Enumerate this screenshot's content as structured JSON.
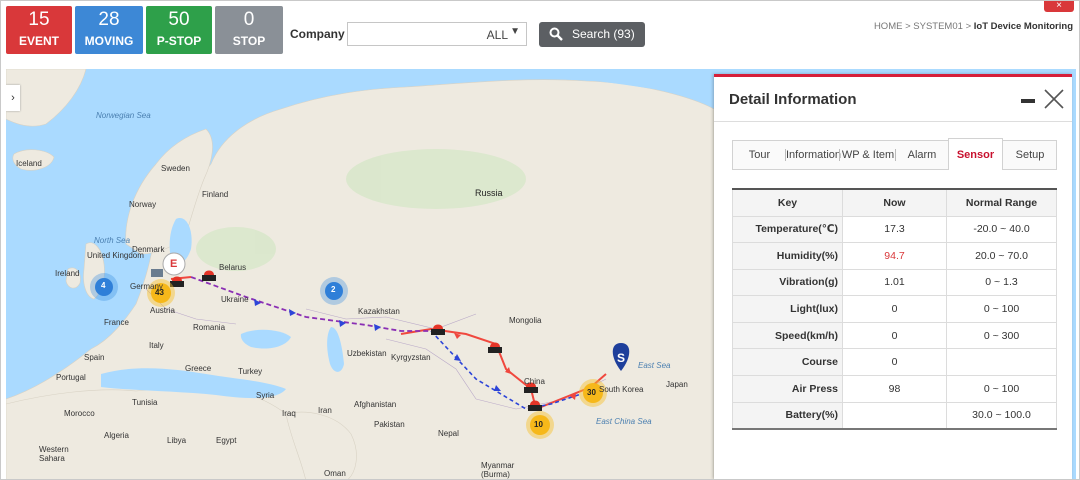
{
  "stats": [
    {
      "count": "15",
      "label": "EVENT",
      "color": "#d9383a"
    },
    {
      "count": "28",
      "label": "MOVING",
      "color": "#3d88d6"
    },
    {
      "count": "50",
      "label": "P-STOP",
      "color": "#2ea04a"
    },
    {
      "count": "0",
      "label": "STOP",
      "color": "#8a9097"
    }
  ],
  "filter": {
    "company_label": "Company :",
    "company_value": "ALL",
    "search_label": "Search (93)"
  },
  "breadcrumb": {
    "home": "HOME",
    "sep1": ">",
    "system": "SYSTEM01",
    "sep2": ">",
    "current": "IoT Device Monitoring"
  },
  "map": {
    "labels": {
      "norwegian_sea": "Norwegian Sea",
      "iceland": "Iceland",
      "sweden": "Sweden",
      "finland": "Finland",
      "norway": "Norway",
      "north_sea": "North Sea",
      "united_kingdom": "United Kingdom",
      "denmark": "Denmark",
      "ireland": "Ireland",
      "belarus": "Belarus",
      "germany": "Germany",
      "ukraine": "Ukraine",
      "france": "France",
      "austria": "Austria",
      "romania": "Romania",
      "kazakhstan": "Kazakhstan",
      "mongolia": "Mongolia",
      "russia": "Russia",
      "spain": "Spain",
      "italy": "Italy",
      "portugal": "Portugal",
      "greece": "Greece",
      "turkey": "Turkey",
      "uzbekistan": "Uzbekistan",
      "kyrgyzstan": "Kyrgyzstan",
      "tunisia": "Tunisia",
      "syria": "Syria",
      "iraq": "Iraq",
      "iran": "Iran",
      "afghanistan": "Afghanistan",
      "pakistan": "Pakistan",
      "nepal": "Nepal",
      "china": "China",
      "morocco": "Morocco",
      "algeria": "Algeria",
      "libya": "Libya",
      "egypt": "Egypt",
      "western_sahara": "Western Sahara",
      "oman": "Oman",
      "myanmar": "Myanmar (Burma)",
      "south_korea": "South Korea",
      "japan": "Japan",
      "east_sea": "East Sea",
      "east_china_sea": "East China Sea"
    },
    "clusters": [
      {
        "count": "4",
        "kind": "blue"
      },
      {
        "count": "2",
        "kind": "blue"
      },
      {
        "count": "43",
        "kind": "yellow"
      },
      {
        "count": "30",
        "kind": "yellow"
      },
      {
        "count": "10",
        "kind": "yellow"
      }
    ],
    "start_marker": "S",
    "end_marker": "E",
    "colors": {
      "route_red": "#f0483e",
      "route_blue": "#2d45d8",
      "route_purple": "#8a2fb4",
      "event": "#e53528"
    }
  },
  "detail": {
    "title": "Detail Information",
    "tabs": [
      {
        "label": "Tour",
        "active": false
      },
      {
        "label": "Information",
        "active": false
      },
      {
        "label": "WP & Item",
        "active": false
      },
      {
        "label": "Alarm",
        "active": false
      },
      {
        "label": "Sensor",
        "active": true
      },
      {
        "label": "Setup",
        "active": false
      }
    ],
    "table": {
      "headers": [
        "Key",
        "Now",
        "Normal Range"
      ],
      "rows": [
        {
          "key": "Temperature(℃)",
          "now": "17.3",
          "range": "-20.0 ~ 40.0"
        },
        {
          "key": "Humidity(%)",
          "now": "94.7",
          "range": "20.0 ~ 70.0"
        },
        {
          "key": "Vibration(g)",
          "now": "1.01",
          "range": "0 ~ 1.3"
        },
        {
          "key": "Light(lux)",
          "now": "0",
          "range": "0 ~ 100"
        },
        {
          "key": "Speed(km/h)",
          "now": "0",
          "range": "0 ~ 300"
        },
        {
          "key": "Course",
          "now": "0",
          "range": ""
        },
        {
          "key": "Air Press",
          "now": "98",
          "range": "0 ~ 100"
        },
        {
          "key": "Battery(%)",
          "now": "",
          "range": "30.0 ~ 100.0"
        }
      ]
    }
  }
}
